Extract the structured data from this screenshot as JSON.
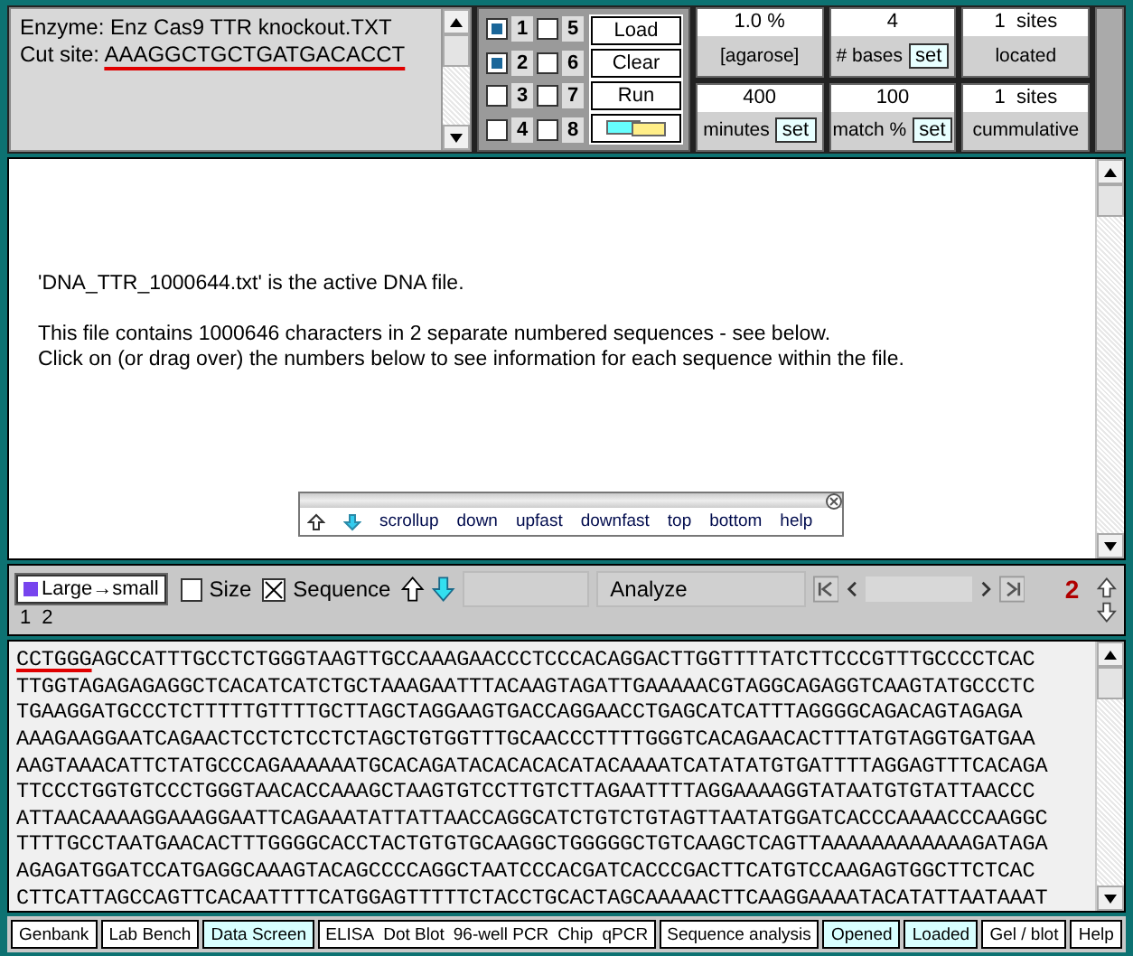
{
  "enzyme": {
    "label": "Enzyme: Enz Cas9 TTR knockout.TXT",
    "cut_prefix": "Cut site: ",
    "cut_site": "AAAGGCTGCTGATGACACCT"
  },
  "lanes": [
    {
      "label": "1",
      "checked": true
    },
    {
      "label": "2",
      "checked": true
    },
    {
      "label": "3",
      "checked": false
    },
    {
      "label": "4",
      "checked": false
    },
    {
      "label": "5",
      "checked": false
    },
    {
      "label": "6",
      "checked": false
    },
    {
      "label": "7",
      "checked": false
    },
    {
      "label": "8",
      "checked": false
    }
  ],
  "gel_buttons": [
    "Load",
    "Clear",
    "Run"
  ],
  "stats": [
    {
      "value": "1.0 %",
      "label": "[agarose]"
    },
    {
      "value": "4",
      "label": "# bases",
      "button": "set"
    },
    {
      "value": "1  sites",
      "label": "located"
    },
    {
      "value": "400",
      "label": "minutes",
      "button": "set"
    },
    {
      "value": "100",
      "label": "match %",
      "button": "set"
    },
    {
      "value": "1  sites",
      "label": "cummulative"
    }
  ],
  "info": [
    "'DNA_TTR_1000644.txt' is the active DNA file.",
    "This file contains 1000646 characters in 2 separate numbered sequences - see below.\nClick on (or drag over) the numbers below to see information for each sequence within the file."
  ],
  "scroll_toolbar": [
    "scrollup",
    "down",
    "upfast",
    "downfast",
    "top",
    "bottom",
    "help"
  ],
  "controls": {
    "sort_button": "Large→small",
    "size": {
      "label": "Size",
      "checked": false
    },
    "sequence": {
      "label": "Sequence",
      "checked": true
    },
    "analyze": "Analyze",
    "count": "2",
    "sequence_numbers": [
      "1",
      "2"
    ]
  },
  "sequence": {
    "marked": "CCTGGG",
    "lines": [
      "AGCCATTTGCCTCTGGGTAAGTTGCCAAAGAACCCTCCCACAGGACTTGGTTTTATCTTCCCGTTTGCCCCTCAC",
      "TTGGTAGAGAGAGGCTCACATCATCTGCTAAAGAATTTACAAGTAGATTGAAAAACGTAGGCAGAGGTCAAGTATGCCCTC",
      "TGAAGGATGCCCTCTTTTTGTTTTGCTTAGCTAGGAAGTGACCAGGAACCTGAGCATCATTTAGGGGCAGACAGTAGAGA",
      "AAAGAAGGAATCAGAACTCCTCTCCTCTAGCTGTGGTTTGCAACCCTTTTGGGTCACAGAACACTTTATGTAGGTGATGAA",
      "AAGTAAACATTCTATGCCCAGAAAAAATGCACAGATACACACACATACAAAATCATATATGTGATTTTAGGAGTTTCACAGA",
      "TTCCCTGGTGTCCCTGGGTAACACCAAAGCTAAGTGTCCTTGTCTTAGAATTTTAGGAAAAGGTATAATGTGTATTAACCC",
      "ATTAACAAAAGGAAAGGAATTCAGAAATATTATTAACCAGGCATCTGTCTGTAGTTAATATGGATCACCCAAAACCCAAGGC",
      "TTTTGCCTAATGAACACTTTGGGGCACCTACTGTGTGCAAGGCTGGGGGCTGTCAAGCTCAGTTAAAAAAAAAAAAGATAGA",
      "AGAGATGGATCCATGAGGCAAAGTACAGCCCCAGGCTAATCCCACGATCACCCGACTTCATGTCCAAGAGTGGCTTCTCAC",
      "CTTCATTAGCCAGTTCACAATTTTCATGGAGTTTTTCTACCTGCACTAGCAAAAACTTCAAGGAAAATACATATTAATAAAT"
    ]
  },
  "nav": [
    {
      "label": "Genbank",
      "selected": false
    },
    {
      "label": "Lab Bench",
      "selected": false
    },
    {
      "label": "Data Screen",
      "selected": true
    },
    {
      "kind": "group",
      "items": [
        "ELISA",
        "Dot Blot",
        "96-well PCR",
        "Chip",
        "qPCR"
      ]
    },
    {
      "label": "Sequence analysis",
      "selected": false
    },
    {
      "label": "Opened",
      "selected": true
    },
    {
      "label": "Loaded",
      "selected": true
    },
    {
      "label": "Gel / blot",
      "selected": false
    },
    {
      "label": "Help",
      "selected": false
    }
  ]
}
